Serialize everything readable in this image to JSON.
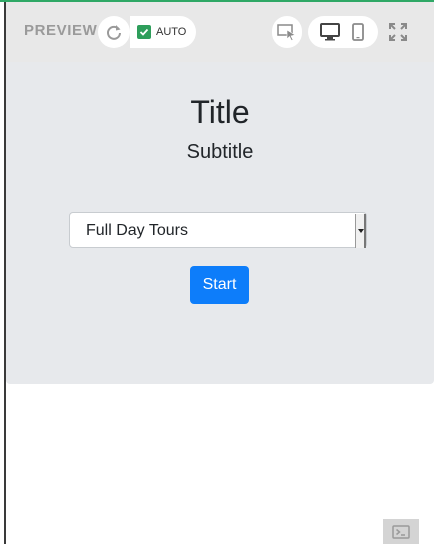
{
  "toolbar": {
    "preview_label": "PREVIEW",
    "auto_label": "AUTO",
    "auto_checked": true,
    "icons": [
      "refresh-icon",
      "cursor-select-icon",
      "desktop-icon",
      "mobile-icon",
      "fullscreen-icon",
      "console-icon"
    ],
    "accent_color": "#2fa866"
  },
  "preview": {
    "title": "Title",
    "subtitle": "Subtitle",
    "select_value": "Full Day Tours",
    "start_label": "Start",
    "button_color": "#0d7dfa"
  }
}
